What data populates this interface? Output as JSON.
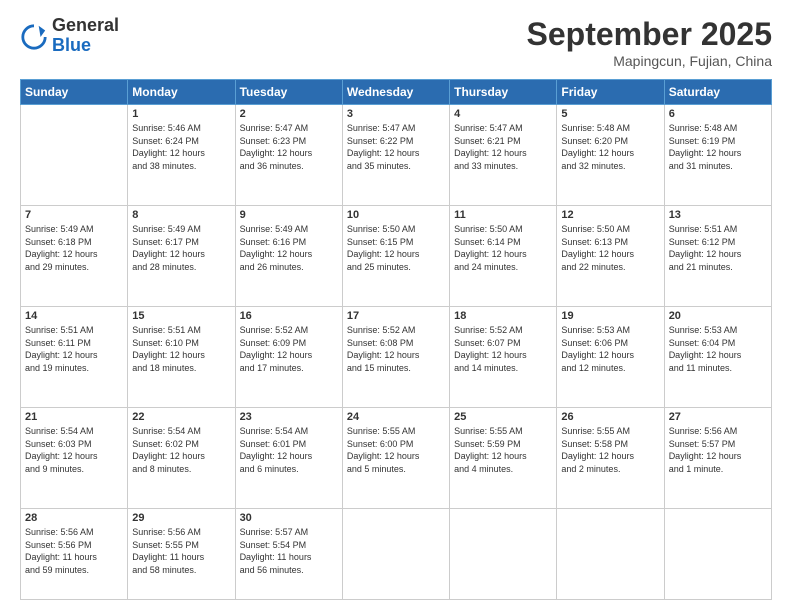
{
  "logo": {
    "general": "General",
    "blue": "Blue"
  },
  "header": {
    "month": "September 2025",
    "location": "Mapingcun, Fujian, China"
  },
  "days_of_week": [
    "Sunday",
    "Monday",
    "Tuesday",
    "Wednesday",
    "Thursday",
    "Friday",
    "Saturday"
  ],
  "weeks": [
    [
      {
        "day": "",
        "info": ""
      },
      {
        "day": "1",
        "info": "Sunrise: 5:46 AM\nSunset: 6:24 PM\nDaylight: 12 hours\nand 38 minutes."
      },
      {
        "day": "2",
        "info": "Sunrise: 5:47 AM\nSunset: 6:23 PM\nDaylight: 12 hours\nand 36 minutes."
      },
      {
        "day": "3",
        "info": "Sunrise: 5:47 AM\nSunset: 6:22 PM\nDaylight: 12 hours\nand 35 minutes."
      },
      {
        "day": "4",
        "info": "Sunrise: 5:47 AM\nSunset: 6:21 PM\nDaylight: 12 hours\nand 33 minutes."
      },
      {
        "day": "5",
        "info": "Sunrise: 5:48 AM\nSunset: 6:20 PM\nDaylight: 12 hours\nand 32 minutes."
      },
      {
        "day": "6",
        "info": "Sunrise: 5:48 AM\nSunset: 6:19 PM\nDaylight: 12 hours\nand 31 minutes."
      }
    ],
    [
      {
        "day": "7",
        "info": "Sunrise: 5:49 AM\nSunset: 6:18 PM\nDaylight: 12 hours\nand 29 minutes."
      },
      {
        "day": "8",
        "info": "Sunrise: 5:49 AM\nSunset: 6:17 PM\nDaylight: 12 hours\nand 28 minutes."
      },
      {
        "day": "9",
        "info": "Sunrise: 5:49 AM\nSunset: 6:16 PM\nDaylight: 12 hours\nand 26 minutes."
      },
      {
        "day": "10",
        "info": "Sunrise: 5:50 AM\nSunset: 6:15 PM\nDaylight: 12 hours\nand 25 minutes."
      },
      {
        "day": "11",
        "info": "Sunrise: 5:50 AM\nSunset: 6:14 PM\nDaylight: 12 hours\nand 24 minutes."
      },
      {
        "day": "12",
        "info": "Sunrise: 5:50 AM\nSunset: 6:13 PM\nDaylight: 12 hours\nand 22 minutes."
      },
      {
        "day": "13",
        "info": "Sunrise: 5:51 AM\nSunset: 6:12 PM\nDaylight: 12 hours\nand 21 minutes."
      }
    ],
    [
      {
        "day": "14",
        "info": "Sunrise: 5:51 AM\nSunset: 6:11 PM\nDaylight: 12 hours\nand 19 minutes."
      },
      {
        "day": "15",
        "info": "Sunrise: 5:51 AM\nSunset: 6:10 PM\nDaylight: 12 hours\nand 18 minutes."
      },
      {
        "day": "16",
        "info": "Sunrise: 5:52 AM\nSunset: 6:09 PM\nDaylight: 12 hours\nand 17 minutes."
      },
      {
        "day": "17",
        "info": "Sunrise: 5:52 AM\nSunset: 6:08 PM\nDaylight: 12 hours\nand 15 minutes."
      },
      {
        "day": "18",
        "info": "Sunrise: 5:52 AM\nSunset: 6:07 PM\nDaylight: 12 hours\nand 14 minutes."
      },
      {
        "day": "19",
        "info": "Sunrise: 5:53 AM\nSunset: 6:06 PM\nDaylight: 12 hours\nand 12 minutes."
      },
      {
        "day": "20",
        "info": "Sunrise: 5:53 AM\nSunset: 6:04 PM\nDaylight: 12 hours\nand 11 minutes."
      }
    ],
    [
      {
        "day": "21",
        "info": "Sunrise: 5:54 AM\nSunset: 6:03 PM\nDaylight: 12 hours\nand 9 minutes."
      },
      {
        "day": "22",
        "info": "Sunrise: 5:54 AM\nSunset: 6:02 PM\nDaylight: 12 hours\nand 8 minutes."
      },
      {
        "day": "23",
        "info": "Sunrise: 5:54 AM\nSunset: 6:01 PM\nDaylight: 12 hours\nand 6 minutes."
      },
      {
        "day": "24",
        "info": "Sunrise: 5:55 AM\nSunset: 6:00 PM\nDaylight: 12 hours\nand 5 minutes."
      },
      {
        "day": "25",
        "info": "Sunrise: 5:55 AM\nSunset: 5:59 PM\nDaylight: 12 hours\nand 4 minutes."
      },
      {
        "day": "26",
        "info": "Sunrise: 5:55 AM\nSunset: 5:58 PM\nDaylight: 12 hours\nand 2 minutes."
      },
      {
        "day": "27",
        "info": "Sunrise: 5:56 AM\nSunset: 5:57 PM\nDaylight: 12 hours\nand 1 minute."
      }
    ],
    [
      {
        "day": "28",
        "info": "Sunrise: 5:56 AM\nSunset: 5:56 PM\nDaylight: 11 hours\nand 59 minutes."
      },
      {
        "day": "29",
        "info": "Sunrise: 5:56 AM\nSunset: 5:55 PM\nDaylight: 11 hours\nand 58 minutes."
      },
      {
        "day": "30",
        "info": "Sunrise: 5:57 AM\nSunset: 5:54 PM\nDaylight: 11 hours\nand 56 minutes."
      },
      {
        "day": "",
        "info": ""
      },
      {
        "day": "",
        "info": ""
      },
      {
        "day": "",
        "info": ""
      },
      {
        "day": "",
        "info": ""
      }
    ]
  ]
}
